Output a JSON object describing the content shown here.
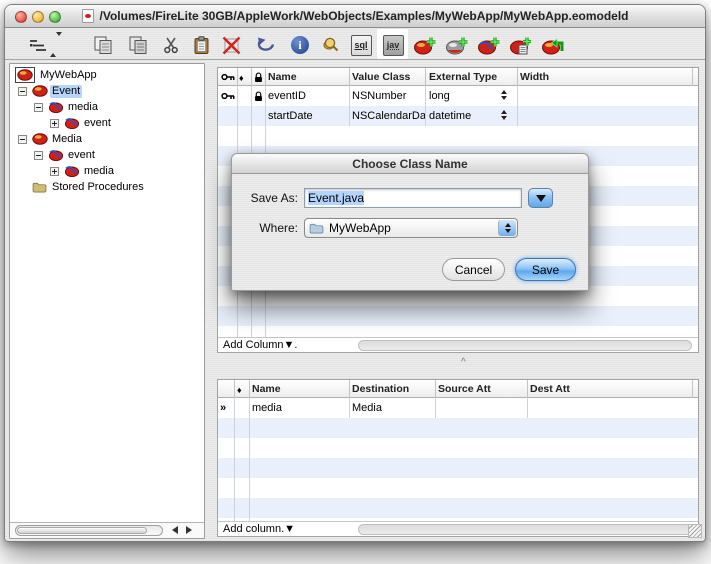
{
  "window": {
    "title": "/Volumes/FireLite 30GB/AppleWork/WebObjects/Examples/MyWebApp/MyWebApp.eomodeld"
  },
  "toolbar": {
    "sql_label": "sql",
    "jav_label": "jav",
    "info_glyph": "i"
  },
  "sidebar": {
    "tree": [
      {
        "label": "MyWebApp"
      },
      {
        "label": "Event"
      },
      {
        "label": "media"
      },
      {
        "label": "event"
      },
      {
        "label": "Media"
      },
      {
        "label": "event"
      },
      {
        "label": "media"
      },
      {
        "label": "Stored Procedures"
      }
    ]
  },
  "attributes_table": {
    "headers": {
      "name": "Name",
      "value_class": "Value Class",
      "external_type": "External Type",
      "width": "Width"
    },
    "rows": [
      {
        "name": "eventID",
        "value_class": "NSNumber",
        "external_type": "long"
      },
      {
        "name": "startDate",
        "value_class": "NSCalendarDa",
        "external_type": "datetime"
      }
    ],
    "footer": "Add Column▼."
  },
  "relationships_table": {
    "headers": {
      "name": "Name",
      "destination": "Destination",
      "source_att": "Source Att",
      "dest_att": "Dest Att"
    },
    "rows": [
      {
        "marker": "»",
        "name": "media",
        "destination": "Media",
        "source_att": "",
        "dest_att": ""
      }
    ],
    "footer": "Add column.▼"
  },
  "dialog": {
    "title": "Choose Class Name",
    "save_as_label": "Save As:",
    "save_as_value": "Event.java",
    "where_label": "Where:",
    "where_value": "MyWebApp",
    "cancel_label": "Cancel",
    "save_label": "Save"
  },
  "glyphs": {
    "diamond": "♦",
    "splitter_caret": "^"
  },
  "colors": {
    "stripe_blue": "#e9f0fb",
    "selection_blue": "#b5d5fd",
    "aqua_blue": "#5fa8ee"
  }
}
